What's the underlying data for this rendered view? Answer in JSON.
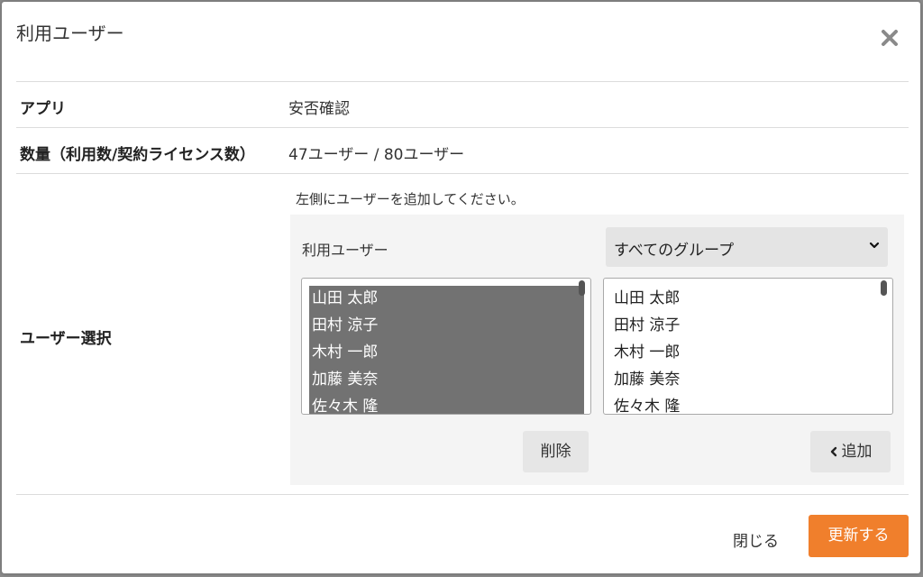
{
  "dialog": {
    "title": "利用ユーザー"
  },
  "rows": {
    "app_label": "アプリ",
    "app_value": "安否確認",
    "quantity_label": "数量（利用数/契約ライセンス数）",
    "quantity_value": "47ユーザー / 80ユーザー",
    "user_select_label": "ユーザー選択"
  },
  "selector": {
    "hint": "左側にユーザーを追加してください。",
    "panel_title": "利用ユーザー",
    "group_select_value": "すべてのグループ",
    "left_list": [
      "山田 太郎",
      "田村 涼子",
      "木村 一郎",
      "加藤 美奈",
      "佐々木 隆"
    ],
    "right_list": [
      "山田 太郎",
      "田村 涼子",
      "木村 一郎",
      "加藤 美奈",
      "佐々木 隆"
    ],
    "delete_label": "削除",
    "add_label": "追加"
  },
  "footer": {
    "close_label": "閉じる",
    "update_label": "更新する"
  },
  "colors": {
    "accent": "#f07f2c",
    "selected_bg": "#727272"
  },
  "icons": {
    "close": "close-icon",
    "group_dropdown": "chevron-down-icon",
    "add": "chevron-left-icon"
  }
}
